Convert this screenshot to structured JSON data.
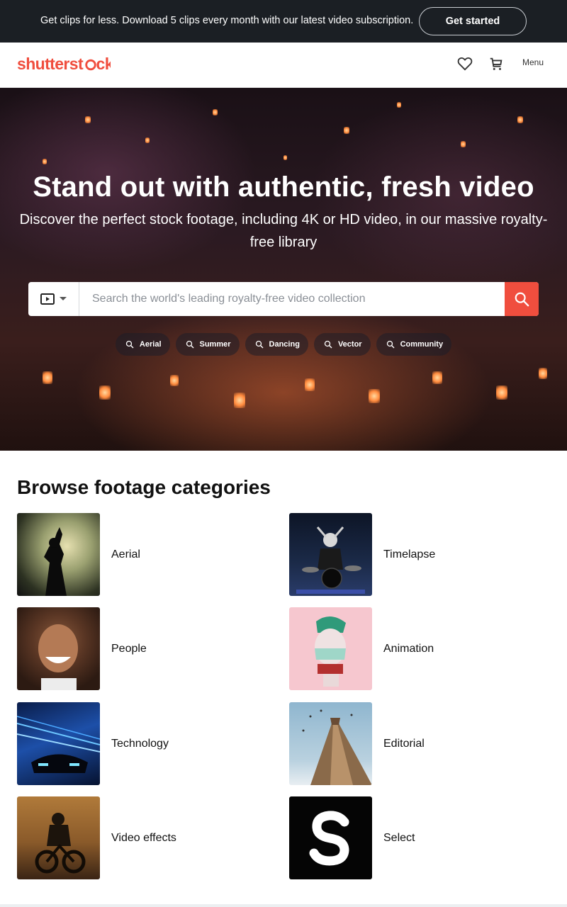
{
  "promo": {
    "text": "Get clips for less. Download 5 clips every month with our latest video subscription.",
    "cta": "Get started"
  },
  "header": {
    "logo_text": "shutterstock",
    "menu_label": "Menu",
    "icons": [
      "heart-icon",
      "cart-icon"
    ]
  },
  "hero": {
    "title": "Stand out with authentic, fresh video",
    "subtitle": "Discover the perfect stock footage, including 4K or HD video, in our massive royalty-free library",
    "search": {
      "placeholder": "Search the world's leading royalty-free video collection",
      "type_icon": "video-icon"
    },
    "chips": [
      "Aerial",
      "Summer",
      "Dancing",
      "Vector",
      "Community"
    ]
  },
  "categories": {
    "title": "Browse footage categories",
    "items": [
      {
        "label": "Aerial"
      },
      {
        "label": "Timelapse"
      },
      {
        "label": "People"
      },
      {
        "label": "Animation"
      },
      {
        "label": "Technology"
      },
      {
        "label": "Editorial"
      },
      {
        "label": "Video effects"
      },
      {
        "label": "Select"
      }
    ]
  },
  "colors": {
    "brand": "#f04e3e",
    "promo_bg": "#1b1f24"
  }
}
